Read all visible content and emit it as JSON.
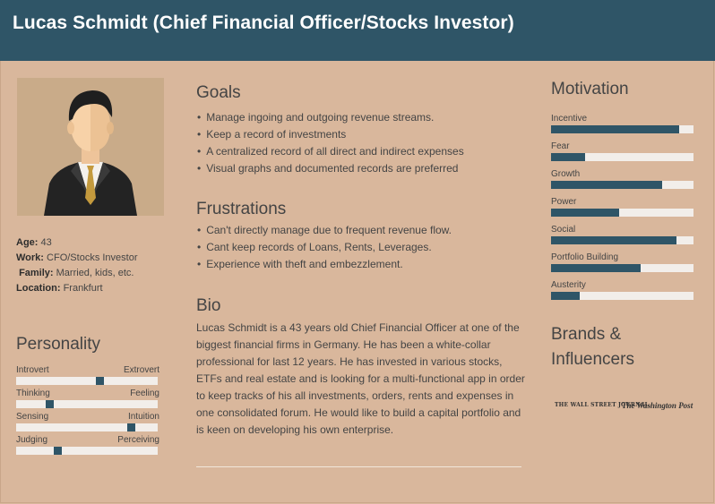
{
  "header": {
    "title": "Lucas Schmidt (Chief Financial Officer/Stocks Investor)"
  },
  "profile": {
    "age_label": "Age:",
    "age": "43",
    "work_label": "Work:",
    "work": "CFO/Stocks Investor",
    "family_label": "Family:",
    "family": "Married, kids, etc.",
    "location_label": "Location:",
    "location": "Frankfurt"
  },
  "personality": {
    "title": "Personality",
    "traits": [
      {
        "left": "Introvert",
        "right": "Extrovert",
        "value": 0.6
      },
      {
        "left": "Thinking",
        "right": "Feeling",
        "value": 0.22
      },
      {
        "left": "Sensing",
        "right": "Intuition",
        "value": 0.83
      },
      {
        "left": "Judging",
        "right": "Perceiving",
        "value": 0.28
      }
    ]
  },
  "goals": {
    "title": "Goals",
    "items": [
      "Manage ingoing and outgoing revenue streams.",
      "Keep a record of investments",
      "A centralized record of all direct and indirect expenses",
      "Visual graphs and documented records are preferred"
    ]
  },
  "frustrations": {
    "title": "Frustrations",
    "items": [
      "Can't directly manage due to frequent revenue flow.",
      "Cant keep records of Loans, Rents, Leverages.",
      "Experience with theft  and embezzlement."
    ]
  },
  "bio": {
    "title": "Bio",
    "text": "Lucas Schmidt is a 43 years old Chief Financial Officer at one of the biggest financial firms in Germany. He has been a white-collar professional for last 12 years. He has invested in various stocks, ETFs and real estate and is looking for a multi-functional app in order to keep tracks of his all investments, orders, rents and expenses in one consolidated forum. He would like to build a capital portfolio and is keen on developing his own enterprise."
  },
  "motivation": {
    "title": "Motivation",
    "items": [
      {
        "label": "Incentive",
        "value": 0.9
      },
      {
        "label": "Fear",
        "value": 0.24
      },
      {
        "label": "Growth",
        "value": 0.78
      },
      {
        "label": "Power",
        "value": 0.48
      },
      {
        "label": "Social",
        "value": 0.88
      },
      {
        "label": "Portfolio Building",
        "value": 0.63
      },
      {
        "label": "Austerity",
        "value": 0.2
      }
    ]
  },
  "brands": {
    "title_line1": "Brands &",
    "title_line2": "Influencers",
    "logos": [
      "THE WALL STREET JOURNAL.",
      "The Washington Post"
    ]
  },
  "colors": {
    "header": "#2f5567",
    "background": "#d9b79c",
    "bar": "#2f5567",
    "track": "#f2eeea"
  },
  "icons": {
    "avatar": "businessman-avatar-icon"
  }
}
